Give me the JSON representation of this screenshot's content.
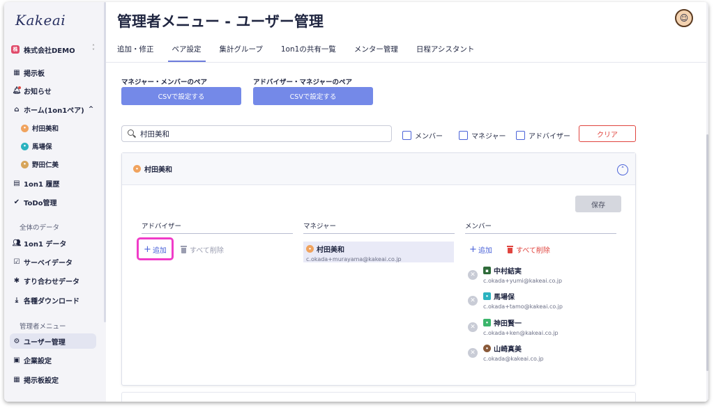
{
  "app": {
    "logo": "Kakeai"
  },
  "sidebar": {
    "company": {
      "badge": "株",
      "name": "株式会社DEMO"
    },
    "items": [
      {
        "label": "掲示板",
        "icon": "board-icon"
      },
      {
        "label": "お知らせ",
        "icon": "bell-icon"
      },
      {
        "label": "ホーム(1on1ペア)",
        "icon": "home-icon",
        "chevron": "^"
      },
      {
        "label": "村田美和",
        "icon": "avatar-icon"
      },
      {
        "label": "馬場保",
        "icon": "avatar-icon"
      },
      {
        "label": "野田仁美",
        "icon": "avatar-icon"
      },
      {
        "label": "1on1 履歴",
        "icon": "history-icon"
      },
      {
        "label": "ToDo管理",
        "icon": "check-circle-icon"
      }
    ],
    "section_data": "全体のデータ",
    "data_items": [
      {
        "label": "1on1 データ",
        "icon": "people-icon"
      },
      {
        "label": "サーベイデータ",
        "icon": "survey-icon"
      },
      {
        "label": "すり合わせデータ",
        "icon": "puzzle-icon"
      },
      {
        "label": "各種ダウンロード",
        "icon": "download-icon"
      }
    ],
    "section_admin": "管理者メニュー",
    "admin_items": [
      {
        "label": "ユーザー管理",
        "icon": "user-admin-icon",
        "active": true
      },
      {
        "label": "企業設定",
        "icon": "building-icon"
      },
      {
        "label": "掲示板設定",
        "icon": "board-settings-icon"
      }
    ]
  },
  "header": {
    "title": "管理者メニュー - ユーザー管理"
  },
  "tabs": [
    {
      "label": "追加・修正"
    },
    {
      "label": "ペア設定",
      "active": true
    },
    {
      "label": "集計グループ"
    },
    {
      "label": "1on1の共有一覧"
    },
    {
      "label": "メンター管理"
    },
    {
      "label": "日程アシスタント"
    }
  ],
  "pairs": {
    "manager_member": {
      "label": "マネジャー・メンバーのペア",
      "button": "CSVで設定する"
    },
    "advisor_manager": {
      "label": "アドバイザー・マネジャーのペア",
      "button": "CSVで設定する"
    }
  },
  "search": {
    "value": "村田美和"
  },
  "filters": {
    "member": "メンバー",
    "manager": "マネジャー",
    "advisor": "アドバイザー",
    "clear": "クリア"
  },
  "card": {
    "name": "村田美和",
    "save": "保存",
    "advisor": {
      "header": "アドバイザー",
      "add": "追加",
      "delete_all": "すべて削除"
    },
    "manager": {
      "header": "マネジャー",
      "name": "村田美和",
      "email": "c.okada+murayama@kakeai.co.jp"
    },
    "members_col": {
      "header": "メンバー",
      "add": "追加",
      "delete_all": "すべて削除",
      "list": [
        {
          "name": "中村結実",
          "email": "c.okada+yumi@kakeai.co.jp"
        },
        {
          "name": "馬場保",
          "email": "c.okada+tamo@kakeai.co.jp"
        },
        {
          "name": "神田賢一",
          "email": "c.okada+ken@kakeai.co.jp"
        },
        {
          "name": "山崎真美",
          "email": "c.okada@kakeai.co.jp"
        }
      ]
    }
  },
  "colors": {
    "accent": "#7489e8",
    "danger": "#e0443e",
    "highlight": "#f03cc8"
  }
}
